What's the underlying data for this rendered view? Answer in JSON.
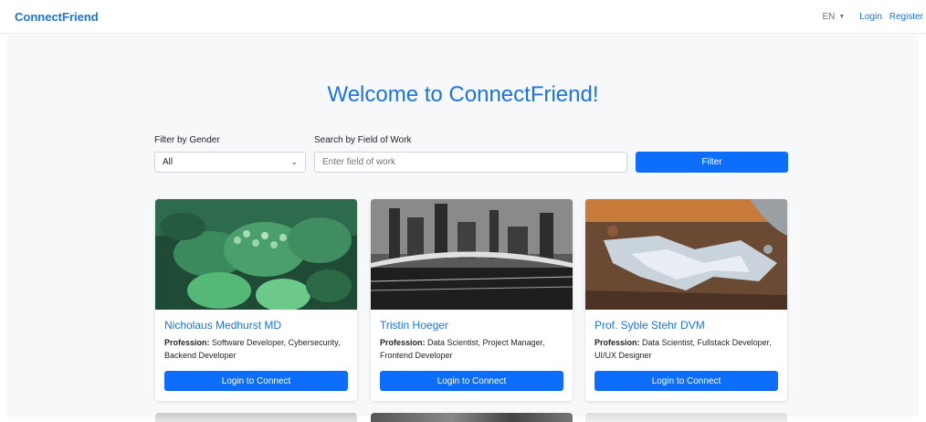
{
  "nav": {
    "brand": "ConnectFriend",
    "language": "EN",
    "login": "Login",
    "register": "Register"
  },
  "main": {
    "title": "Welcome to ConnectFriend!",
    "filters": {
      "gender_label": "Filter by Gender",
      "gender_value": "All",
      "work_label": "Search by Field of Work",
      "work_placeholder": "Enter field of work",
      "filter_button": "Filter"
    },
    "profession_label": "Profession:",
    "cards": [
      {
        "name": "Nicholaus Medhurst MD",
        "profession": "Software Developer, Cybersecurity, Backend Developer",
        "button": "Login to Connect"
      },
      {
        "name": "Tristin Hoeger",
        "profession": "Data Scientist, Project Manager, Frontend Developer",
        "button": "Login to Connect"
      },
      {
        "name": "Prof. Syble Stehr DVM",
        "profession": "Data Scientist, Fullstack Developer, UI/UX Designer",
        "button": "Login to Connect"
      }
    ]
  },
  "colors": {
    "accent": "#1a73e8",
    "button": "#0d6efd",
    "background": "#f7f8fa"
  }
}
